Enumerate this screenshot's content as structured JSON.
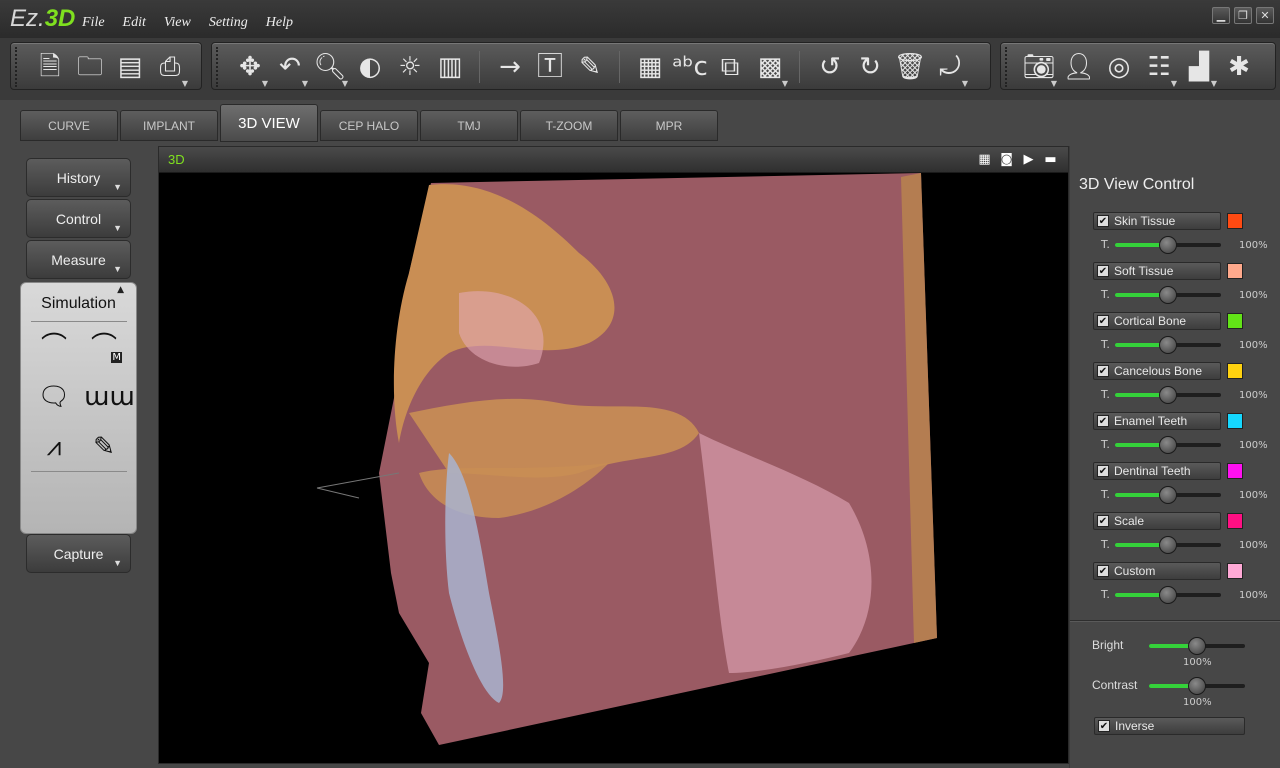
{
  "app": {
    "logo_prefix": "Ez.",
    "logo_suffix": "3D"
  },
  "menu": [
    "File",
    "Edit",
    "View",
    "Setting",
    "Help"
  ],
  "window_controls": [
    "minimize-icon",
    "restore-icon",
    "close-icon"
  ],
  "toolbar": {
    "group1": [
      "new-document-icon",
      "open-folder-icon",
      "save-icon",
      "print-icon"
    ],
    "group2": [
      "move-icon",
      "undo-rotate-icon",
      "zoom-icon",
      "contrast-icon",
      "brightness-icon",
      "columns-icon",
      "arrow-icon",
      "text-icon",
      "pencil-icon",
      "layers-icon",
      "abc-icon",
      "cube-icon",
      "checkerboard-icon",
      "undo-icon",
      "redo-icon",
      "trash-icon",
      "reset-icon"
    ],
    "group3": [
      "camera-icon",
      "person-icon",
      "target-icon",
      "sliders-icon",
      "image-icon",
      "tools-icon"
    ]
  },
  "tabs": [
    "CURVE",
    "IMPLANT",
    "3D VIEW",
    "CEP HALO",
    "TMJ",
    "T-ZOOM",
    "MPR"
  ],
  "active_tab": "3D VIEW",
  "left_panel": {
    "history": "History",
    "control": "Control",
    "measure": "Measure",
    "simulation_title": "Simulation",
    "simulation_icons": [
      "arch-icon",
      "arch-m-icon",
      "teeth-front-icon",
      "teeth-row-icon",
      "waveform-icon",
      "brush-icon"
    ],
    "capture": "Capture"
  },
  "viewport": {
    "title": "3D",
    "icons": [
      "grid-icon",
      "camera-icon",
      "play-icon",
      "maximize-icon"
    ]
  },
  "right_panel": {
    "title": "3D View Control",
    "t_label": "T.",
    "layers": [
      {
        "name": "Skin Tissue",
        "color": "#ff4a12",
        "checked": true,
        "value": "100%",
        "level": 0.5
      },
      {
        "name": "Soft Tissue",
        "color": "#ffa98c",
        "checked": true,
        "value": "100%",
        "level": 0.5
      },
      {
        "name": "Cortical Bone",
        "color": "#62e317",
        "checked": true,
        "value": "100%",
        "level": 0.5
      },
      {
        "name": "Cancelous Bone",
        "color": "#ffd20f",
        "checked": true,
        "value": "100%",
        "level": 0.5
      },
      {
        "name": "Enamel Teeth",
        "color": "#15d8ff",
        "checked": true,
        "value": "100%",
        "level": 0.5
      },
      {
        "name": "Dentinal Teeth",
        "color": "#ff10f1",
        "checked": true,
        "value": "100%",
        "level": 0.5
      },
      {
        "name": "Scale",
        "color": "#ff0f83",
        "checked": true,
        "value": "100%",
        "level": 0.5
      },
      {
        "name": "Custom",
        "color": "#ffa9d6",
        "checked": true,
        "value": "100%",
        "level": 0.5
      }
    ],
    "bright": {
      "label": "Bright",
      "value": "100%",
      "level": 0.5
    },
    "contrast": {
      "label": "Contrast",
      "value": "100%",
      "level": 0.5
    },
    "inverse": {
      "label": "Inverse",
      "checked": true
    }
  }
}
